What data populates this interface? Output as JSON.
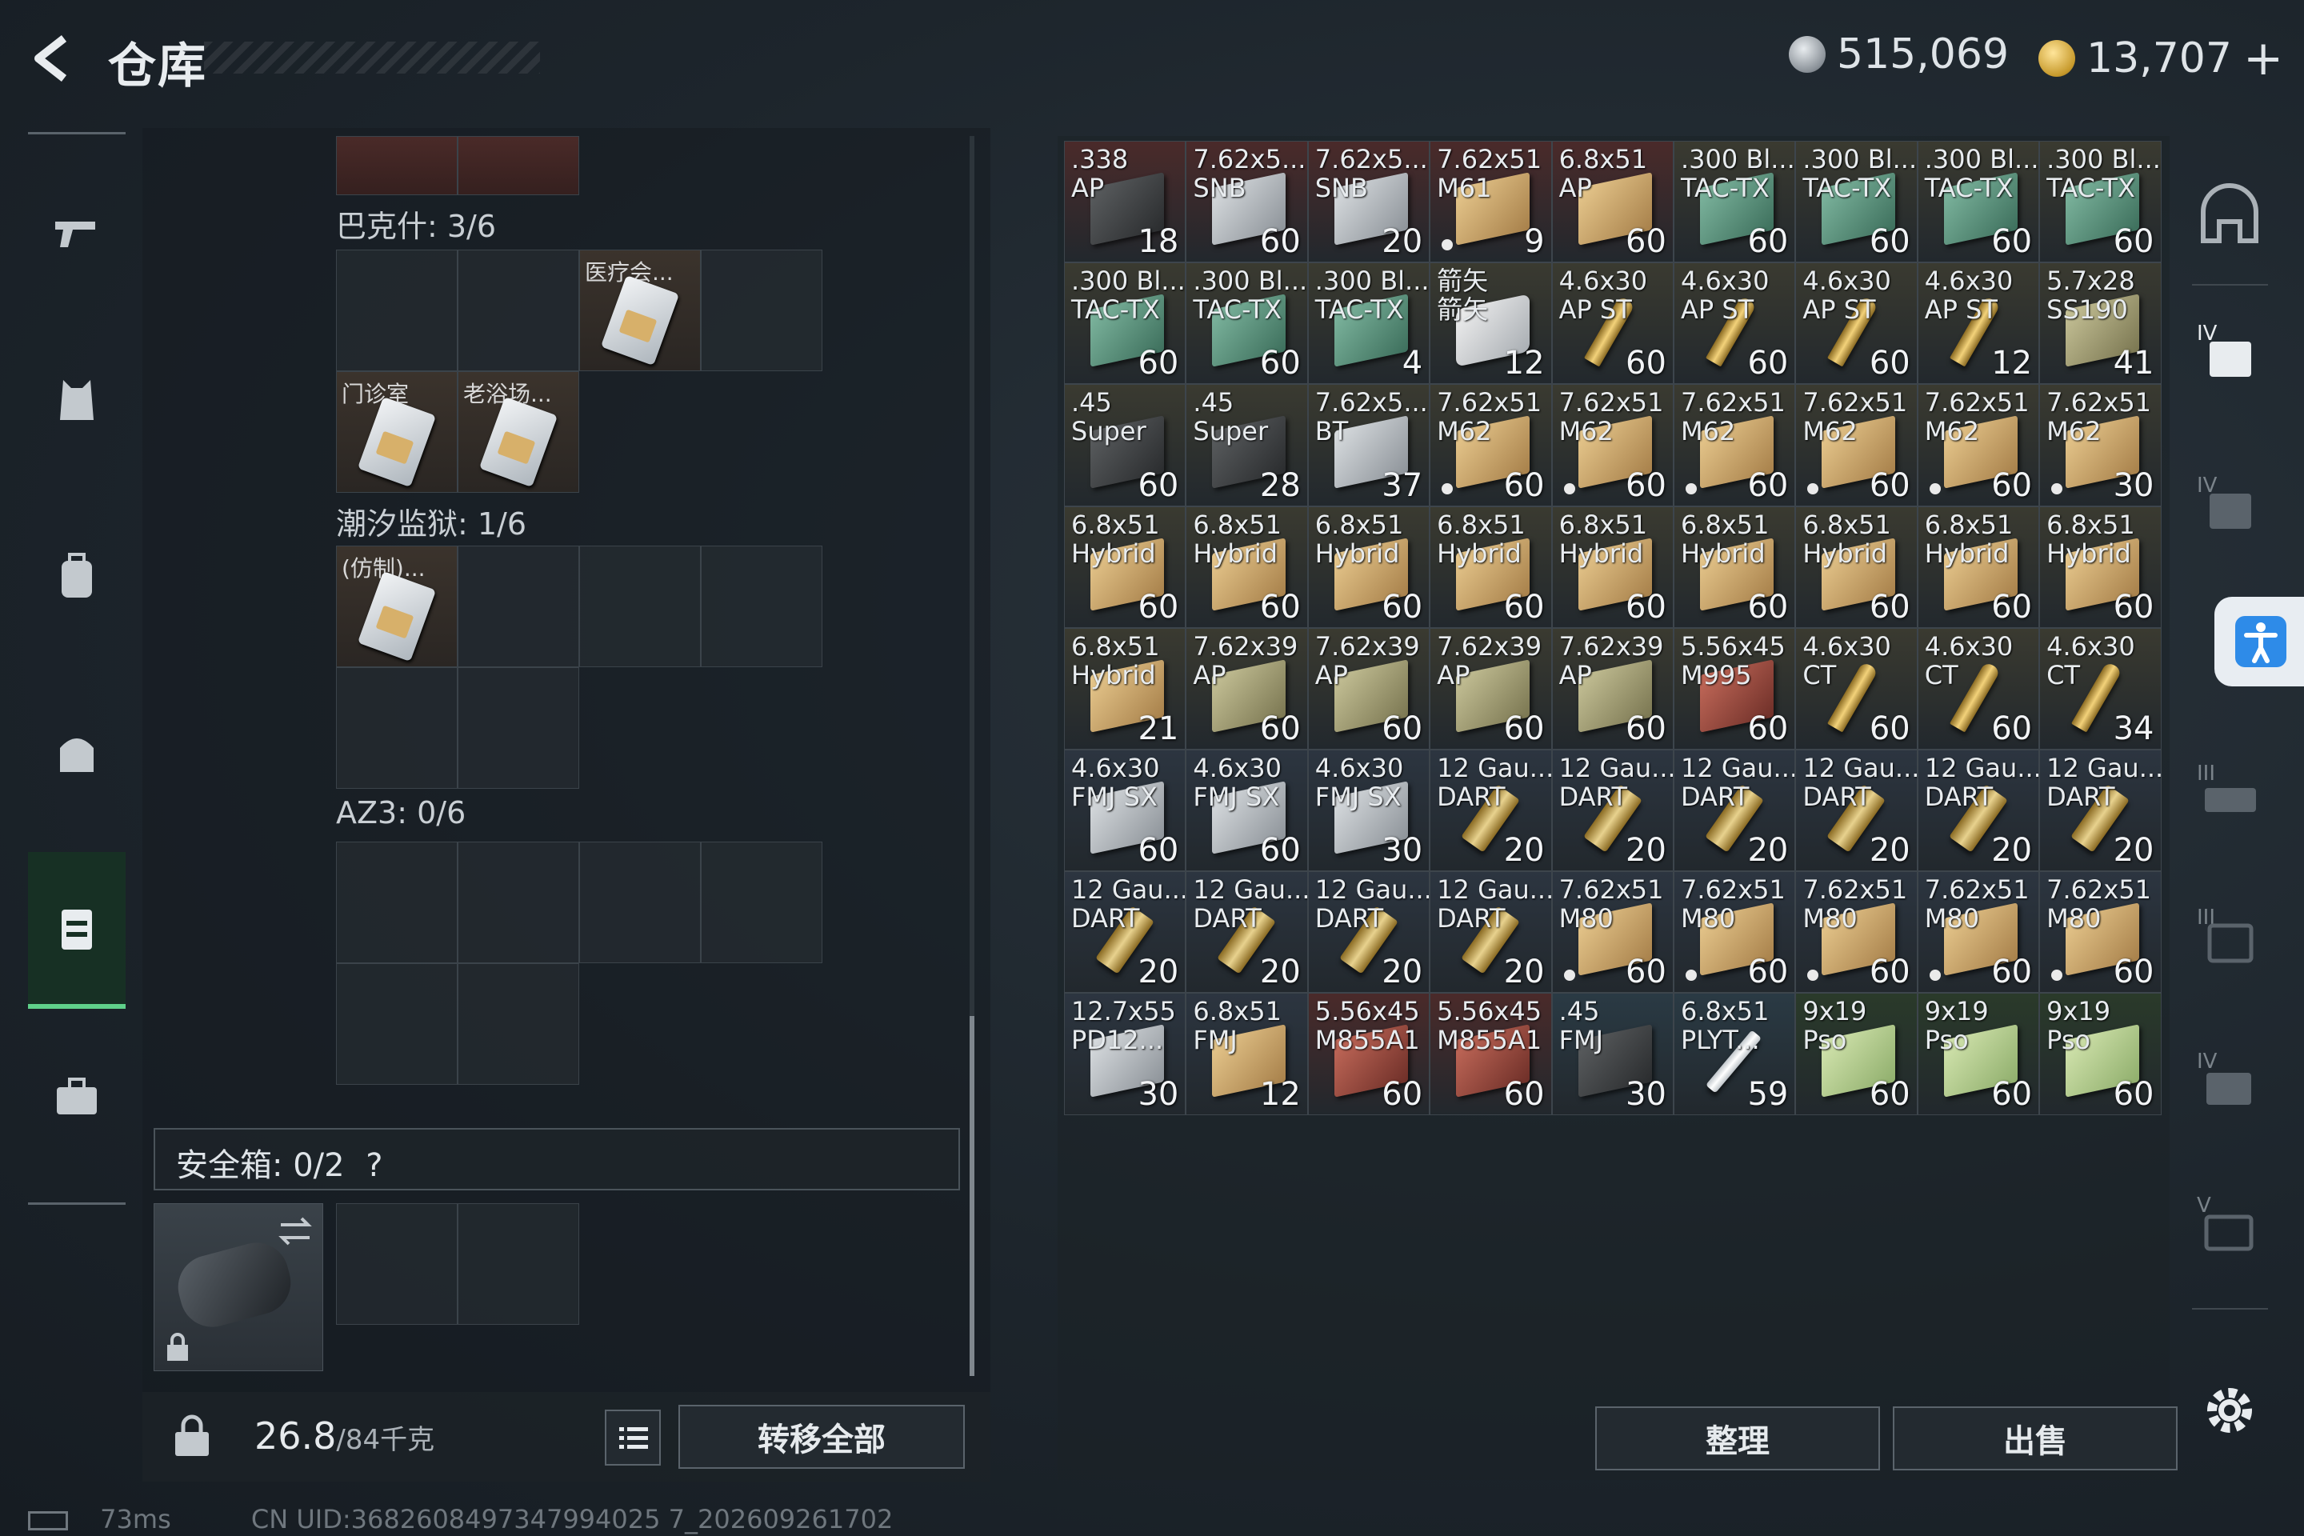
{
  "header": {
    "title": "仓库",
    "silver": "515,069",
    "gold": "13,707",
    "gold_plus": "+"
  },
  "containers": [
    {
      "label": "巴克什: 3/6"
    },
    {
      "label": "潮汐监狱: 1/6"
    },
    {
      "label": "AZ3: 0/6"
    }
  ],
  "keycards": {
    "bakeshi_1": "医疗会...",
    "bakeshi_2": "门诊室",
    "bakeshi_3": "老浴场...",
    "prison_1": "(仿制)..."
  },
  "safebox": {
    "label": "安全箱: 0/2",
    "help": "?"
  },
  "footer_left": {
    "weight": "26.8",
    "capacity": "/84千克",
    "transfer_all": "转移全部"
  },
  "footer_right": {
    "sort": "整理",
    "sell": "出售"
  },
  "status": {
    "ping": "73ms",
    "uid": "CN UID:3682608497347994025 7_202609261702"
  },
  "grid": [
    {
      "name": ".338\nAP",
      "qty": "18",
      "bg": "#4a2a2a",
      "icon": "dark"
    },
    {
      "name": "7.62x5...\nSNB",
      "qty": "60",
      "bg": "#4a2a2a",
      "icon": "gray"
    },
    {
      "name": "7.62x5...\nSNB",
      "qty": "20",
      "bg": "#4a2a2a",
      "icon": "gray"
    },
    {
      "name": "7.62x51\nM61",
      "qty": "9",
      "bg": "#4a2a2a",
      "icon": "tan",
      "dot": true
    },
    {
      "name": "6.8x51\nAP",
      "qty": "60",
      "bg": "#4a2a2a",
      "icon": "tan"
    },
    {
      "name": ".300 Bl...\nTAC-TX",
      "qty": "60",
      "bg": "#3a3a30",
      "icon": "green"
    },
    {
      "name": ".300 Bl...\nTAC-TX",
      "qty": "60",
      "bg": "#3a3a30",
      "icon": "green"
    },
    {
      "name": ".300 Bl...\nTAC-TX",
      "qty": "60",
      "bg": "#3a3a30",
      "icon": "green"
    },
    {
      "name": ".300 Bl...\nTAC-TX",
      "qty": "60",
      "bg": "#3a3a30",
      "icon": "green"
    },
    {
      "name": ".300 Bl...\nTAC-TX",
      "qty": "60",
      "bg": "#3a3a30",
      "icon": "green"
    },
    {
      "name": ".300 Bl...\nTAC-TX",
      "qty": "60",
      "bg": "#3a3a30",
      "icon": "green"
    },
    {
      "name": ".300 Bl...\nTAC-TX",
      "qty": "4",
      "bg": "#3a3a30",
      "icon": "green"
    },
    {
      "name": "箭矢\n箭矢",
      "qty": "12",
      "bg": "#3a3a30",
      "icon": "tin"
    },
    {
      "name": "4.6x30\nAP ST",
      "qty": "60",
      "bg": "#3a3a30",
      "icon": "bullet"
    },
    {
      "name": "4.6x30\nAP ST",
      "qty": "60",
      "bg": "#3a3a30",
      "icon": "bullet"
    },
    {
      "name": "4.6x30\nAP ST",
      "qty": "60",
      "bg": "#3a3a30",
      "icon": "bullet"
    },
    {
      "name": "4.6x30\nAP ST",
      "qty": "12",
      "bg": "#3a3a30",
      "icon": "bullet"
    },
    {
      "name": "5.7x28\nSS190",
      "qty": "41",
      "bg": "#3a3a30",
      "icon": "olive"
    },
    {
      "name": ".45\nSuper",
      "qty": "60",
      "bg": "#3a3a30",
      "icon": "dark"
    },
    {
      "name": ".45\nSuper",
      "qty": "28",
      "bg": "#3a3a30",
      "icon": "dark"
    },
    {
      "name": "7.62x5...\nBT",
      "qty": "37",
      "bg": "#3a3a30",
      "icon": "gray"
    },
    {
      "name": "7.62x51\nM62",
      "qty": "60",
      "bg": "#3a3a30",
      "icon": "tan",
      "dot": true
    },
    {
      "name": "7.62x51\nM62",
      "qty": "60",
      "bg": "#3a3a30",
      "icon": "tan",
      "dot": true
    },
    {
      "name": "7.62x51\nM62",
      "qty": "60",
      "bg": "#3a3a30",
      "icon": "tan",
      "dot": true
    },
    {
      "name": "7.62x51\nM62",
      "qty": "60",
      "bg": "#3a3a30",
      "icon": "tan",
      "dot": true
    },
    {
      "name": "7.62x51\nM62",
      "qty": "60",
      "bg": "#3a3a30",
      "icon": "tan",
      "dot": true
    },
    {
      "name": "7.62x51\nM62",
      "qty": "30",
      "bg": "#3a3a30",
      "icon": "tan",
      "dot": true
    },
    {
      "name": "6.8x51\nHybrid",
      "qty": "60",
      "bg": "#3a3a30",
      "icon": "tan"
    },
    {
      "name": "6.8x51\nHybrid",
      "qty": "60",
      "bg": "#3a3a30",
      "icon": "tan"
    },
    {
      "name": "6.8x51\nHybrid",
      "qty": "60",
      "bg": "#3a3a30",
      "icon": "tan"
    },
    {
      "name": "6.8x51\nHybrid",
      "qty": "60",
      "bg": "#3a3a30",
      "icon": "tan"
    },
    {
      "name": "6.8x51\nHybrid",
      "qty": "60",
      "bg": "#3a3a30",
      "icon": "tan"
    },
    {
      "name": "6.8x51\nHybrid",
      "qty": "60",
      "bg": "#3a3a30",
      "icon": "tan"
    },
    {
      "name": "6.8x51\nHybrid",
      "qty": "60",
      "bg": "#3a3a30",
      "icon": "tan"
    },
    {
      "name": "6.8x51\nHybrid",
      "qty": "60",
      "bg": "#3a3a30",
      "icon": "tan"
    },
    {
      "name": "6.8x51\nHybrid",
      "qty": "60",
      "bg": "#3a3a30",
      "icon": "tan"
    },
    {
      "name": "6.8x51\nHybrid",
      "qty": "21",
      "bg": "#3a3a30",
      "icon": "tan"
    },
    {
      "name": "7.62x39\nAP",
      "qty": "60",
      "bg": "#3a3a30",
      "icon": "olive"
    },
    {
      "name": "7.62x39\nAP",
      "qty": "60",
      "bg": "#3a3a30",
      "icon": "olive"
    },
    {
      "name": "7.62x39\nAP",
      "qty": "60",
      "bg": "#3a3a30",
      "icon": "olive"
    },
    {
      "name": "7.62x39\nAP",
      "qty": "60",
      "bg": "#3a3a30",
      "icon": "olive"
    },
    {
      "name": "5.56x45\nM995",
      "qty": "60",
      "bg": "#3a3a30",
      "icon": "red"
    },
    {
      "name": "4.6x30\nCT",
      "qty": "60",
      "bg": "#3a3a30",
      "icon": "bullet"
    },
    {
      "name": "4.6x30\nCT",
      "qty": "60",
      "bg": "#3a3a30",
      "icon": "bullet"
    },
    {
      "name": "4.6x30\nCT",
      "qty": "34",
      "bg": "#3a3a30",
      "icon": "bullet"
    },
    {
      "name": "4.6x30\nFMJ SX",
      "qty": "60",
      "bg": "#2c3540",
      "icon": "gray"
    },
    {
      "name": "4.6x30\nFMJ SX",
      "qty": "60",
      "bg": "#2c3540",
      "icon": "gray"
    },
    {
      "name": "4.6x30\nFMJ SX",
      "qty": "30",
      "bg": "#2c3540",
      "icon": "gray"
    },
    {
      "name": "12 Gau...\nDART",
      "qty": "20",
      "bg": "#2c3540",
      "icon": "shell"
    },
    {
      "name": "12 Gau...\nDART",
      "qty": "20",
      "bg": "#2c3540",
      "icon": "shell"
    },
    {
      "name": "12 Gau...\nDART",
      "qty": "20",
      "bg": "#2c3540",
      "icon": "shell"
    },
    {
      "name": "12 Gau...\nDART",
      "qty": "20",
      "bg": "#2c3540",
      "icon": "shell"
    },
    {
      "name": "12 Gau...\nDART",
      "qty": "20",
      "bg": "#2c3540",
      "icon": "shell"
    },
    {
      "name": "12 Gau...\nDART",
      "qty": "20",
      "bg": "#2c3540",
      "icon": "shell"
    },
    {
      "name": "12 Gau...\nDART",
      "qty": "20",
      "bg": "#2c3540",
      "icon": "shell"
    },
    {
      "name": "12 Gau...\nDART",
      "qty": "20",
      "bg": "#2c3540",
      "icon": "shell"
    },
    {
      "name": "12 Gau...\nDART",
      "qty": "20",
      "bg": "#2c3540",
      "icon": "shell"
    },
    {
      "name": "12 Gau...\nDART",
      "qty": "20",
      "bg": "#2c3540",
      "icon": "shell"
    },
    {
      "name": "7.62x51\nM80",
      "qty": "60",
      "bg": "#2c3540",
      "icon": "tan",
      "dot": true
    },
    {
      "name": "7.62x51\nM80",
      "qty": "60",
      "bg": "#2c3540",
      "icon": "tan",
      "dot": true
    },
    {
      "name": "7.62x51\nM80",
      "qty": "60",
      "bg": "#2c3540",
      "icon": "tan",
      "dot": true
    },
    {
      "name": "7.62x51\nM80",
      "qty": "60",
      "bg": "#2c3540",
      "icon": "tan",
      "dot": true
    },
    {
      "name": "7.62x51\nM80",
      "qty": "60",
      "bg": "#2c3540",
      "icon": "tan",
      "dot": true
    },
    {
      "name": "12.7x55\nPD12...",
      "qty": "30",
      "bg": "#2c3540",
      "icon": "gray"
    },
    {
      "name": "6.8x51\nFMJ",
      "qty": "12",
      "bg": "#2c3540",
      "icon": "tan"
    },
    {
      "name": "5.56x45\nM855A1",
      "qty": "60",
      "bg": "#4a2a2a",
      "icon": "red"
    },
    {
      "name": "5.56x45\nM855A1",
      "qty": "60",
      "bg": "#4a2a2a",
      "icon": "red"
    },
    {
      "name": ".45\nFMJ",
      "qty": "30",
      "bg": "#2a3a44",
      "icon": "dark"
    },
    {
      "name": "6.8x51\nPLYT...",
      "qty": "59",
      "bg": "#2a3a44",
      "icon": "syringe"
    },
    {
      "name": "9x19\nPso",
      "qty": "60",
      "bg": "#2a3a2a",
      "icon": "lgreen"
    },
    {
      "name": "9x19\nPso",
      "qty": "60",
      "bg": "#2a3a2a",
      "icon": "lgreen"
    },
    {
      "name": "9x19\nPso",
      "qty": "60",
      "bg": "#2a3a2a",
      "icon": "lgreen"
    }
  ]
}
